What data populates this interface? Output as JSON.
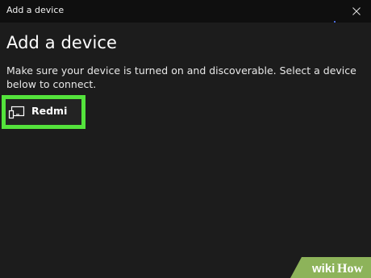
{
  "window": {
    "title": "Add a device",
    "close_icon": "close-icon"
  },
  "main": {
    "heading": "Add a device",
    "description": "Make sure your device is turned on and discoverable. Select a device below to connect."
  },
  "devices": [
    {
      "label": "Redmi",
      "icon": "display-device-icon",
      "selected": true
    }
  ],
  "watermark": {
    "text_wiki": "wiki",
    "text_how": "How"
  },
  "colors": {
    "background": "#1c1c1c",
    "titlebar": "#0f0f0f",
    "highlight": "#54e33c",
    "watermark_green": "#9cc46a"
  }
}
